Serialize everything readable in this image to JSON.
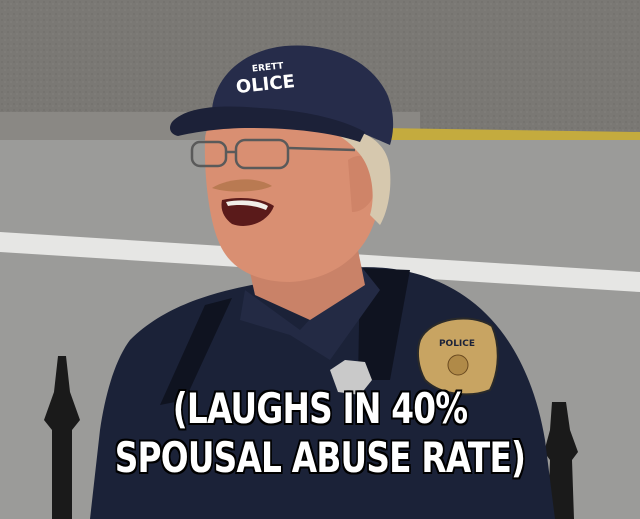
{
  "caption": {
    "line1": "(LAUGHS IN 40%",
    "line2": "SPOUSAL ABUSE RATE)"
  },
  "cap_text": "OLICE",
  "cap_text_small": "ERETT",
  "patch_text": "POLICE",
  "colors": {
    "wall": "#7d7a76",
    "road": "#9a9a98",
    "curb_yellow": "#c8b040",
    "uniform": "#1b2238",
    "cap": "#262c4a",
    "skin": "#d98f72",
    "hair": "#d6c8ae",
    "caption_fill": "#ffffff",
    "caption_stroke": "#000000"
  }
}
